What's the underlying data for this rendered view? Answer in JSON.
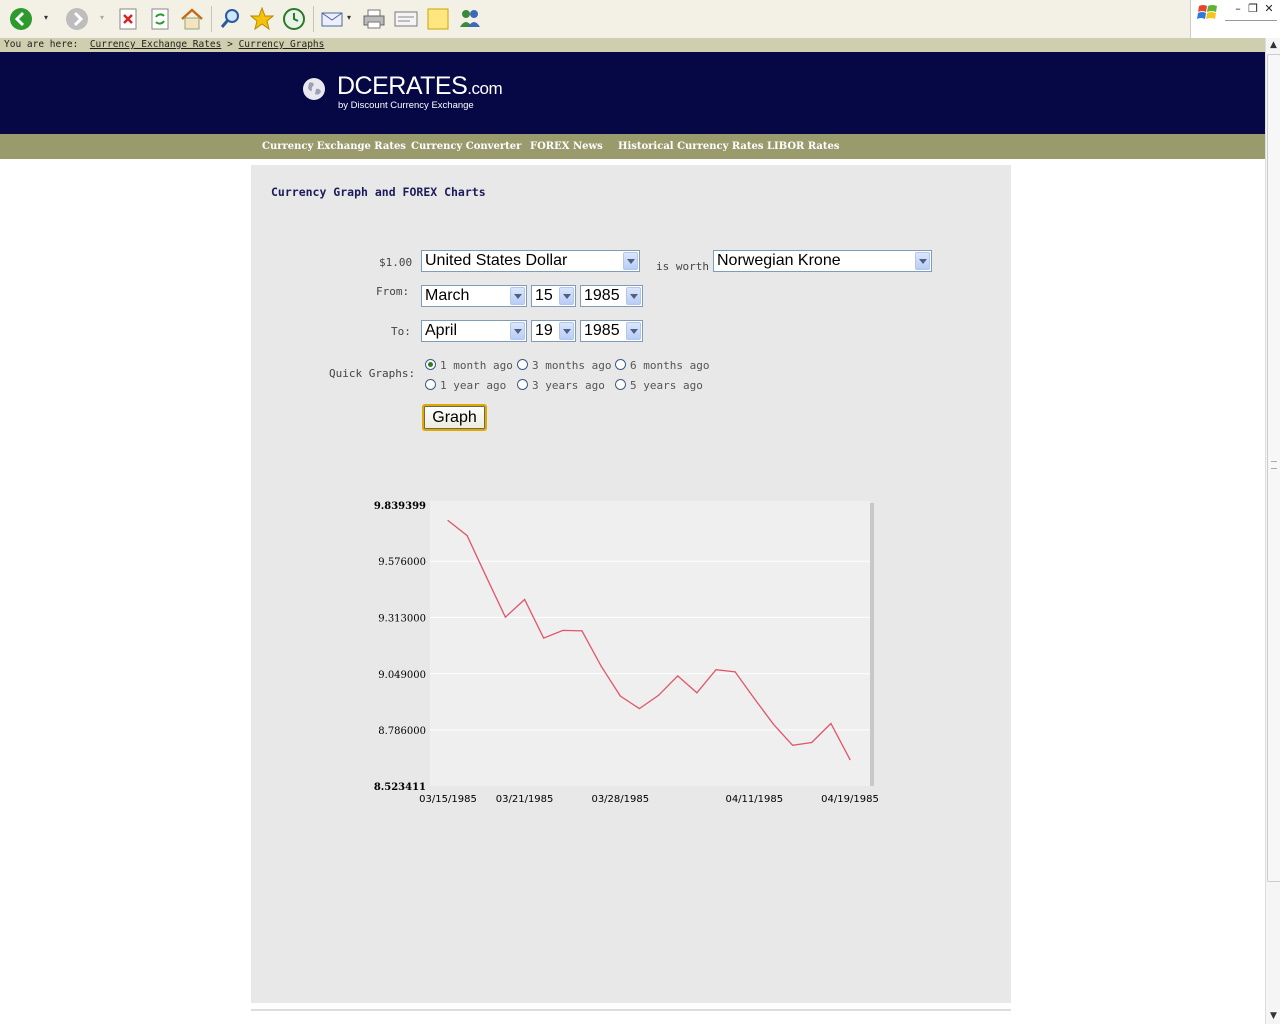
{
  "browser": {
    "toolbar_icons": [
      "back-icon",
      "forward-icon",
      "stop-icon",
      "refresh-icon",
      "home-icon",
      "search-icon",
      "favorites-icon",
      "history-icon",
      "mail-icon",
      "print-icon",
      "edit-icon",
      "note-icon",
      "messenger-icon"
    ]
  },
  "breadcrumb": {
    "prefix": "You are here:",
    "links": [
      "Currency Exchange Rates",
      "Currency Graphs"
    ],
    "separator": ">"
  },
  "brand": {
    "name": "DCERATES",
    "suffix": ".com",
    "tagline": "by Discount Currency Exchange"
  },
  "nav": [
    "Currency Exchange Rates",
    "Currency Converter",
    "FOREX News",
    "Historical Currency Rates",
    "LIBOR Rates"
  ],
  "page": {
    "title": "Currency Graph and FOREX Charts"
  },
  "form": {
    "amount_label": "$1.00",
    "from_currency": "United States Dollar",
    "is_worth_label": "is worth",
    "to_currency": "Norwegian Krone",
    "from_label": "From:",
    "from_month": "March",
    "from_day": "15",
    "from_year": "1985",
    "to_label": "To:",
    "to_month": "April",
    "to_day": "19",
    "to_year": "1985",
    "quick_label": "Quick Graphs:",
    "quick_options": [
      "1 month ago",
      "3 months ago",
      "6 months ago",
      "1 year ago",
      "3 years ago",
      "5 years ago"
    ],
    "quick_selected": "1 month ago",
    "graph_button": "Graph"
  },
  "colors": {
    "banner": "#060745",
    "nav": "#9a9b6d",
    "line": "#e0566a",
    "panel": "#e8e8e8"
  },
  "chart_data": {
    "type": "line",
    "title": "",
    "xlabel": "",
    "ylabel": "",
    "ylim": [
      8.523411,
      9.839399
    ],
    "y_ticks": [
      "9.839399",
      "9.576000",
      "9.313000",
      "9.049000",
      "8.786000",
      "8.523411"
    ],
    "x_ticks": [
      "03/15/1985",
      "03/21/1985",
      "03/28/1985",
      "04/11/1985",
      "04/19/1985"
    ],
    "grid": true,
    "series": [
      {
        "values": [
          9.767,
          9.696,
          9.503,
          9.314,
          9.397,
          9.216,
          9.252,
          9.25,
          9.085,
          8.945,
          8.886,
          8.948,
          9.039,
          8.96,
          9.068,
          9.058,
          8.933,
          8.813,
          8.714,
          8.727,
          8.816,
          8.647
        ]
      }
    ]
  }
}
